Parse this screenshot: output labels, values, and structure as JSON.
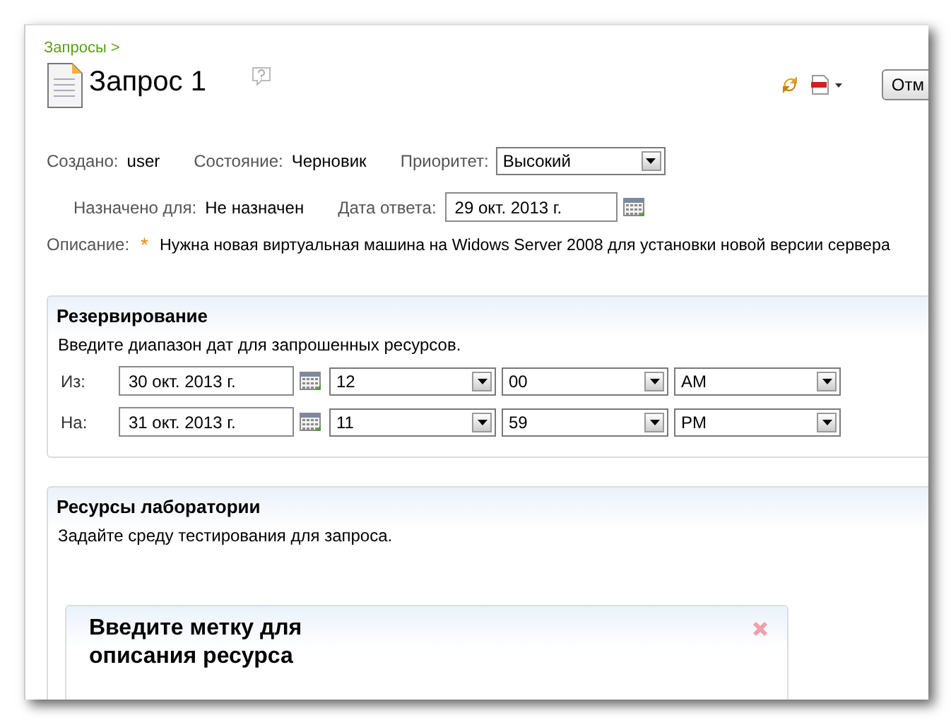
{
  "breadcrumb": "Запросы >",
  "title": "Запрос 1",
  "toolbar": {
    "cancel_button": "Отм"
  },
  "meta": {
    "created_label": "Создано:",
    "created_value": "user",
    "state_label": "Состояние:",
    "state_value": "Черновик",
    "priority_label": "Приоритет:",
    "priority_value": "Высокий"
  },
  "assignment": {
    "assigned_label": "Назначено для:",
    "assigned_value": "Не назначен",
    "due_label": "Дата ответа:",
    "due_value": "29 окт. 2013 г."
  },
  "description": {
    "label": "Описание:",
    "required_mark": "*",
    "text": "Нужна новая виртуальная машина на Widows Server 2008 для установки новой версии сервера"
  },
  "reservation": {
    "title": "Резервирование",
    "hint": "Введите диапазон дат для запрошенных ресурсов.",
    "rows": [
      {
        "label": "Из:",
        "date": "30 окт. 2013 г.",
        "hour": "12",
        "minute": "00",
        "period": "AM"
      },
      {
        "label": "На:",
        "date": "31 окт. 2013 г.",
        "hour": "11",
        "minute": "59",
        "period": "PM"
      }
    ]
  },
  "lab_resources": {
    "title": "Ресурсы лаборатории",
    "hint": "Задайте среду тестирования для запроса.",
    "card": {
      "title": "Введите метку для описания ресурса"
    }
  }
}
